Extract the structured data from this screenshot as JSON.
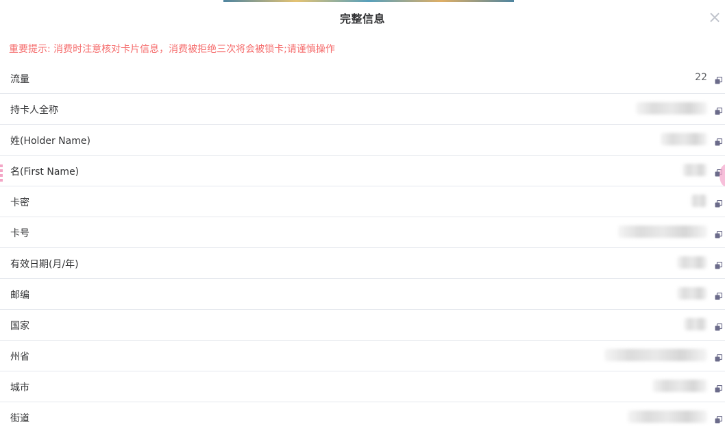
{
  "dialog": {
    "title": "完整信息",
    "close_symbol": "×",
    "notice": "重要提示: 消费时注意核对卡片信息，消费被拒绝三次将会被锁卡;请谨慎操作"
  },
  "fields": [
    {
      "label": "流量",
      "value": "22",
      "redacted": false
    },
    {
      "label": "持卡人全称",
      "value": "",
      "redacted": true
    },
    {
      "label": "姓(Holder Name)",
      "value": "",
      "redacted": true
    },
    {
      "label": "名(First Name)",
      "value": "",
      "redacted": true
    },
    {
      "label": "卡密",
      "value": "",
      "redacted": true
    },
    {
      "label": "卡号",
      "value": "",
      "redacted": true
    },
    {
      "label": "有效日期(月/年)",
      "value": "",
      "redacted": true
    },
    {
      "label": "邮编",
      "value": "",
      "redacted": true
    },
    {
      "label": "国家",
      "value": "",
      "redacted": true
    },
    {
      "label": "州省",
      "value": "",
      "redacted": true
    },
    {
      "label": "城市",
      "value": "",
      "redacted": true
    },
    {
      "label": "街道",
      "value": "",
      "redacted": true
    }
  ],
  "icons": {
    "copy": "copy-icon",
    "close": "close-icon"
  },
  "colors": {
    "notice": "#f56c6c",
    "copy_icon": "#6b6b8a",
    "divider": "#e4e7ed"
  }
}
